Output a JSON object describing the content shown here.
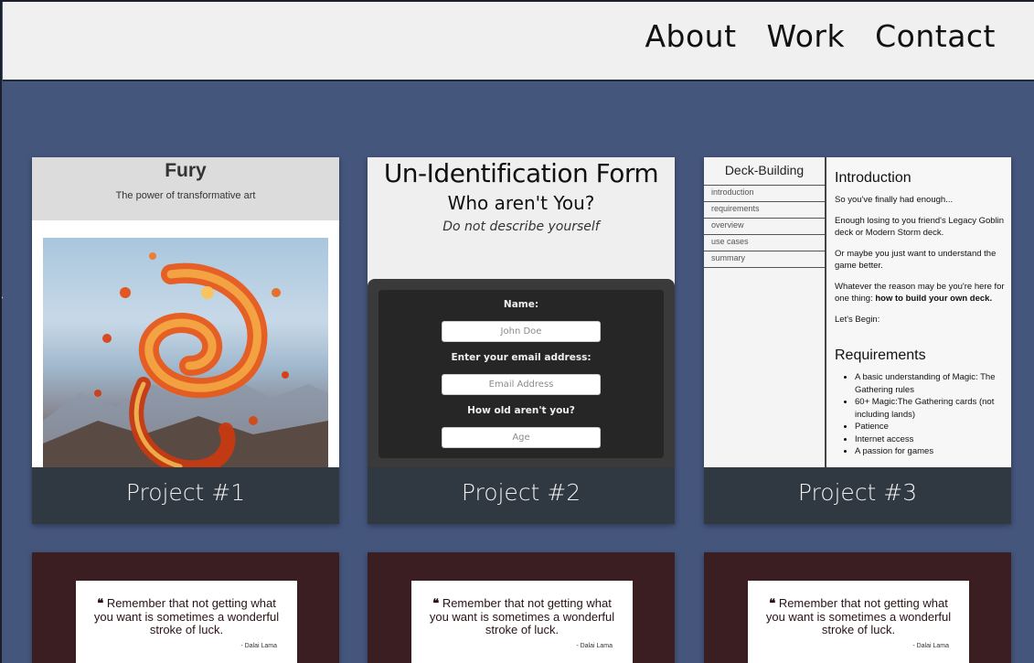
{
  "nav": {
    "links": [
      "About",
      "Work",
      "Contact"
    ]
  },
  "projects": [
    {
      "caption": "Project #1",
      "preview": {
        "title": "Fury",
        "subtitle": "The power of transformative art"
      }
    },
    {
      "caption": "Project #2",
      "preview": {
        "title": "Un-Identification Form",
        "subtitle": "Who aren't You?",
        "description": "Do not describe yourself",
        "fields": [
          {
            "label": "Name:",
            "placeholder": "John Doe"
          },
          {
            "label": "Enter your email address:",
            "placeholder": "Email Address"
          },
          {
            "label": "How old aren't you?",
            "placeholder": "Age"
          }
        ]
      }
    },
    {
      "caption": "Project #3",
      "preview": {
        "nav_title": "Deck-Building",
        "nav_items": [
          "introduction",
          "requirements",
          "overview",
          "use cases",
          "summary"
        ],
        "intro_heading": "Introduction",
        "intro_p1": "So you've finally had enough...",
        "intro_p2": "Enough losing to you friend's Legacy Goblin deck or Modern Storm deck.",
        "intro_p3": "Or maybe you just want to understand the game better.",
        "intro_p4_start": "Whatever the reason may be you're here for one thing: ",
        "intro_p4_bold": "how to build your own deck.",
        "intro_p5": "Let's Begin:",
        "req_heading": "Requirements",
        "req_items": [
          "A basic understanding of Magic: The Gathering rules",
          "60+ Magic:The Gathering cards (not including lands)",
          "Patience",
          "Internet access",
          "A passion for games"
        ]
      }
    }
  ],
  "quotes": [
    {
      "mark": "❝",
      "text": "Remember that not getting what you want is sometimes a wonderful stroke of luck.",
      "author": "- Dalai Lama"
    },
    {
      "mark": "❝",
      "text": "Remember that not getting what you want is sometimes a wonderful stroke of luck.",
      "author": "- Dalai Lama"
    },
    {
      "mark": "❝",
      "text": "Remember that not getting what you want is sometimes a wonderful stroke of luck.",
      "author": "- Dalai Lama"
    }
  ]
}
